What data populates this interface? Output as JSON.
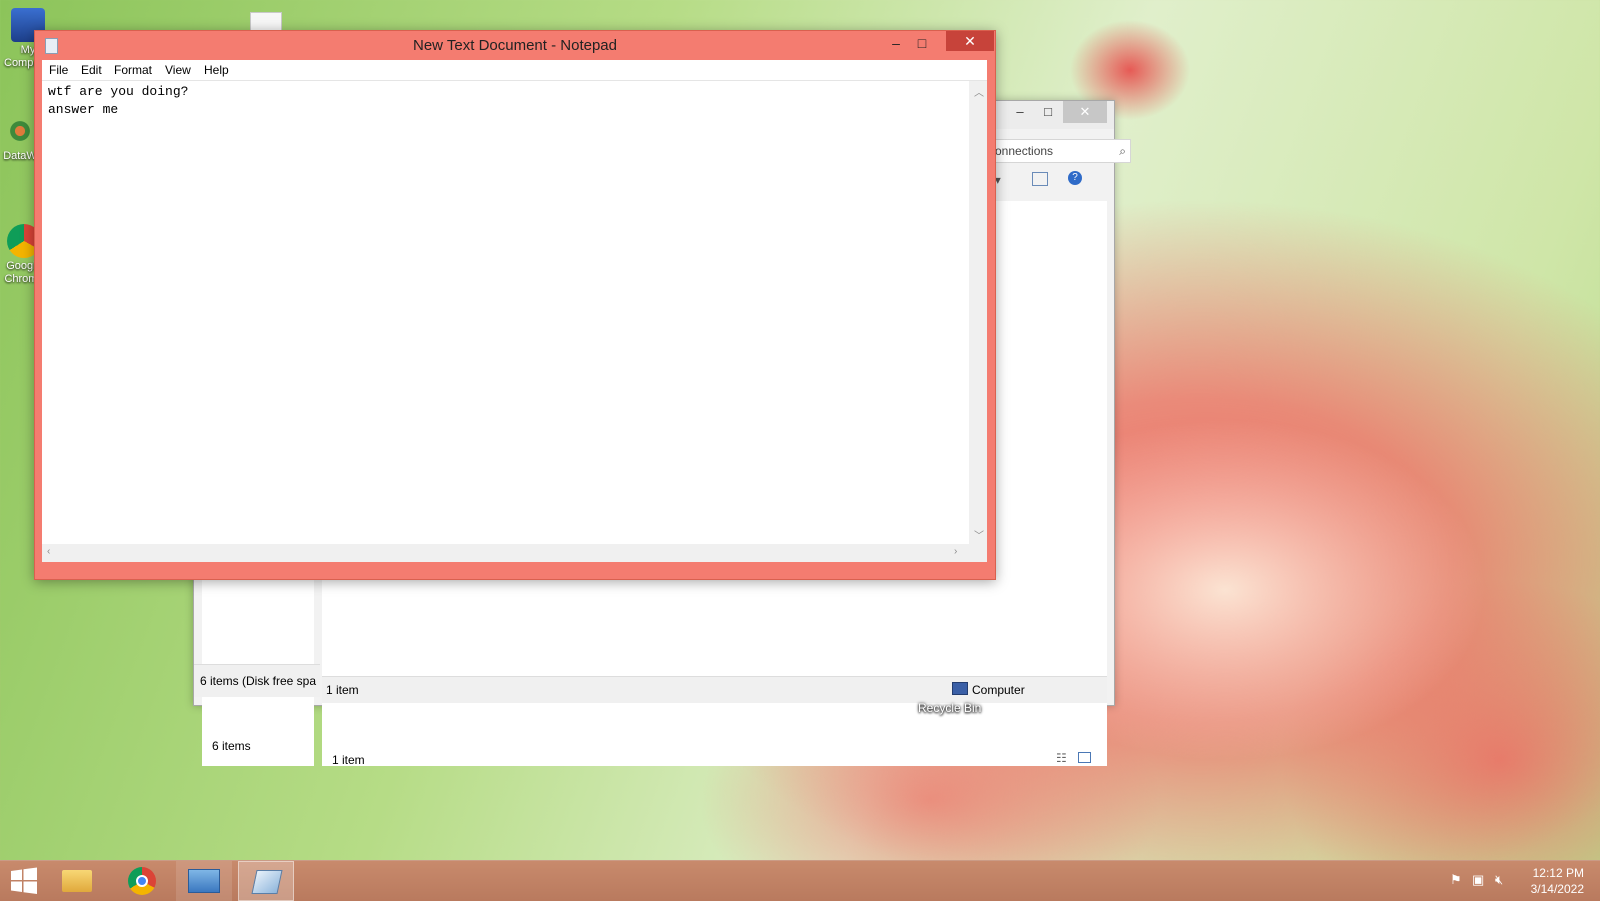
{
  "desktop": {
    "icons": [
      {
        "label": "My Computer",
        "icon": "computer-icon"
      },
      {
        "label": "DataW",
        "icon": "atom-icon"
      },
      {
        "label": "Google Chrome",
        "icon": "chrome-icon"
      }
    ],
    "recycle_bin_label": "Recycle Bin"
  },
  "explorer": {
    "search_placeholder": "onnections",
    "left_items_count": "6 items",
    "left_status": "6 items (Disk free spa",
    "main_items_count": "1 item",
    "status_items": "1 item",
    "status_location": "Computer",
    "minimize": "–",
    "maximize": "□",
    "close": "✕"
  },
  "notepad": {
    "title": "New Text Document - Notepad",
    "menu": [
      "File",
      "Edit",
      "Format",
      "View",
      "Help"
    ],
    "lines": [
      "wtf are you doing?",
      "answer me"
    ],
    "minimize": "–",
    "maximize": "□",
    "close": "✕"
  },
  "taskbar": {
    "time": "12:12 PM",
    "date": "3/14/2022"
  },
  "colors": {
    "notepad_frame": "#f47c70",
    "close_button": "#c7433a",
    "taskbar": "#bd7e61"
  }
}
